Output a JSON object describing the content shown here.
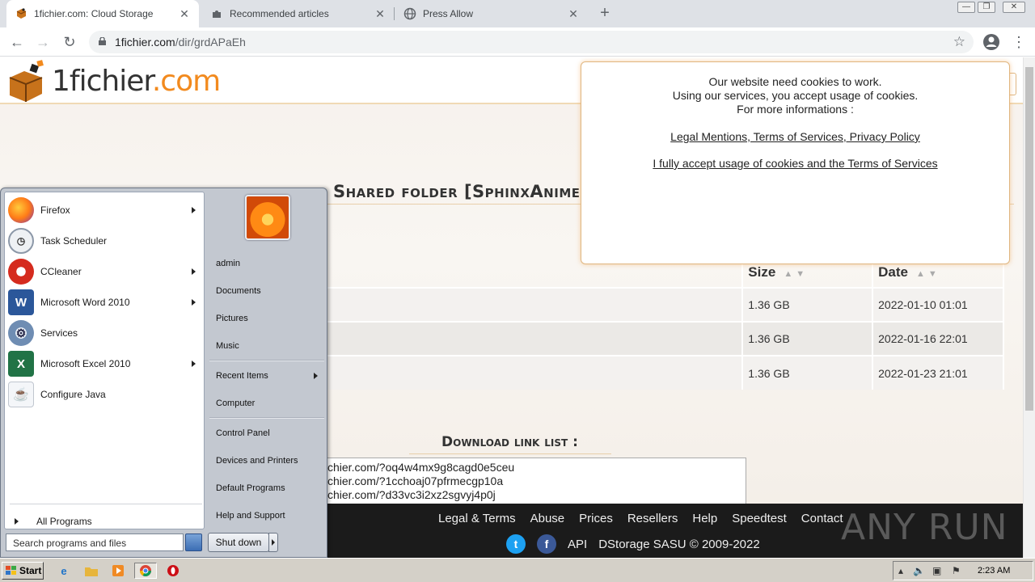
{
  "browser": {
    "tabs": [
      {
        "title": "1fichier.com: Cloud Storage",
        "icon": "fichier-favicon"
      },
      {
        "title": "Recommended articles",
        "icon": "puzzle-icon"
      },
      {
        "title": "Press Allow",
        "icon": "globe-icon"
      }
    ],
    "url_host": "1fichier.com",
    "url_path": "/dir/grdAPaEh"
  },
  "site": {
    "logo_main": "1fichier",
    "logo_tld": ".com",
    "folder_title": "Shared folder [SphinxAnime] S",
    "table": {
      "headers": [
        "Size",
        "Date"
      ],
      "rows": [
        {
          "size": "1.36 GB",
          "date": "2022-01-10 01:01"
        },
        {
          "size": "1.36 GB",
          "date": "2022-01-16 22:01"
        },
        {
          "size": "1.36 GB",
          "date": "2022-01-23 21:01"
        }
      ]
    },
    "download_title": "Download link list :",
    "download_links": [
      "chier.com/?oq4w4mx9g8cagd0e5ceu",
      "chier.com/?1cchoaj07pfrmecgp10a",
      "chier.com/?d33vc3i2xz2sgvyj4p0j"
    ],
    "footer_links": [
      "Legal & Terms",
      "Abuse",
      "Prices",
      "Resellers",
      "Help",
      "Speedtest",
      "Contact"
    ],
    "footer_api": "API",
    "footer_copyright": "DStorage SASU © 2009-2022",
    "watermark": "ANY RUN"
  },
  "cookie": {
    "line1": "Our website need cookies to work.",
    "line2": "Using our services, you accept usage of cookies.",
    "line3": "For more informations :",
    "links": "Legal Mentions, Terms of Services, Privacy Policy",
    "accept": "I fully accept usage of cookies and the Terms of Services"
  },
  "start_menu": {
    "programs": [
      {
        "label": "Firefox",
        "icon": "firefox-icon",
        "arrow": true
      },
      {
        "label": "Task Scheduler",
        "icon": "clock-icon",
        "arrow": false
      },
      {
        "label": "CCleaner",
        "icon": "ccleaner-icon",
        "arrow": true
      },
      {
        "label": "Microsoft Word 2010",
        "icon": "word-icon",
        "arrow": true
      },
      {
        "label": "Services",
        "icon": "gears-icon",
        "arrow": false
      },
      {
        "label": "Microsoft Excel 2010",
        "icon": "excel-icon",
        "arrow": true
      },
      {
        "label": "Configure Java",
        "icon": "java-icon",
        "arrow": false
      }
    ],
    "all_programs": "All Programs",
    "search_placeholder": "Search programs and files",
    "right_items": {
      "user": "admin",
      "documents": "Documents",
      "pictures": "Pictures",
      "music": "Music",
      "recent": "Recent Items",
      "computer": "Computer",
      "control_panel": "Control Panel",
      "devices": "Devices and Printers",
      "defaults": "Default Programs",
      "help": "Help and Support"
    },
    "shutdown": "Shut down"
  },
  "taskbar": {
    "start_label": "Start",
    "clock": "2:23 AM"
  },
  "colors": {
    "accent_orange": "#f28a1e",
    "footer_bg": "#1b1b1b",
    "start_menu_bg": "#c3c8d0"
  }
}
